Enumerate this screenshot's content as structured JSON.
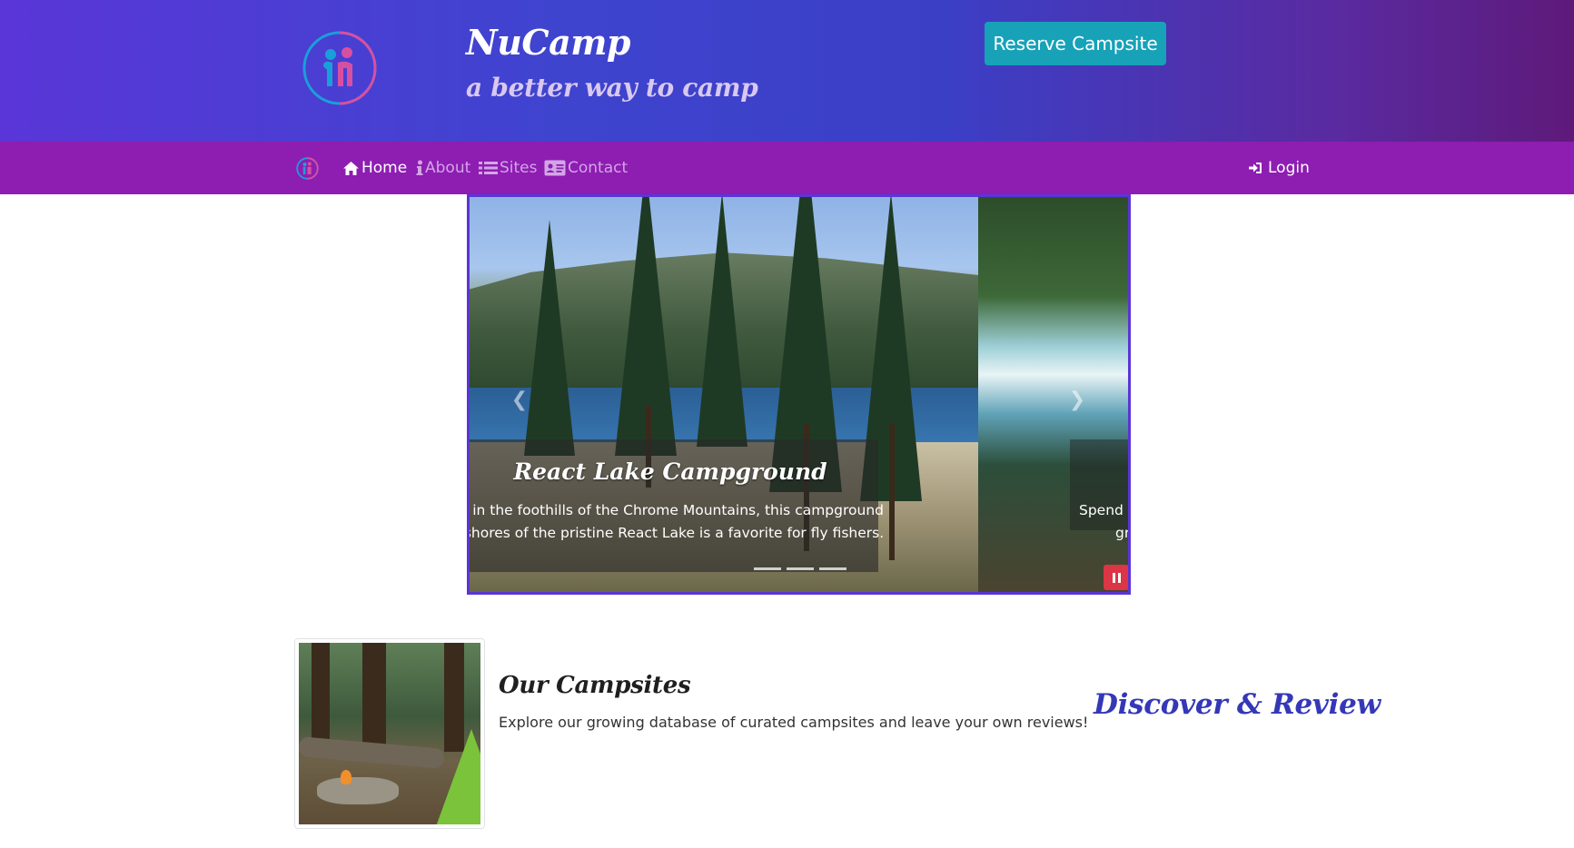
{
  "header": {
    "title": "NuCamp",
    "subtitle": "a better way to camp",
    "reserve_button": "Reserve Campsite",
    "logo_icon": "nucamp-logo-icon"
  },
  "navbar": {
    "items": [
      {
        "label": "Home",
        "icon": "home-icon",
        "active": true
      },
      {
        "label": "About",
        "icon": "info-icon",
        "active": false
      },
      {
        "label": "Sites",
        "icon": "list-icon",
        "active": false
      },
      {
        "label": "Contact",
        "icon": "address-card-icon",
        "active": false
      }
    ],
    "login": {
      "label": "Login",
      "icon": "sign-in-icon"
    }
  },
  "carousel": {
    "slides": [
      {
        "title": "React Lake Campground",
        "caption_line1": "l in the foothills of the Chrome Mountains, this campground",
        "caption_line2": "shores of the pristine React Lake is a favorite for fly fishers."
      },
      {
        "caption_line1": "Spend a",
        "caption_line2": "gr"
      }
    ],
    "indicator_count": 3,
    "colors": {
      "border": "#5a35d6",
      "pause": "#dc3545"
    }
  },
  "media": {
    "title": "Our Campsites",
    "text": "Explore our growing database of curated campsites and leave your own reviews!",
    "tagline": "Discover & Review"
  },
  "colors": {
    "navbar": "#8e1db2",
    "reserve_button": "#17a2b8",
    "tagline": "#3438b7"
  }
}
